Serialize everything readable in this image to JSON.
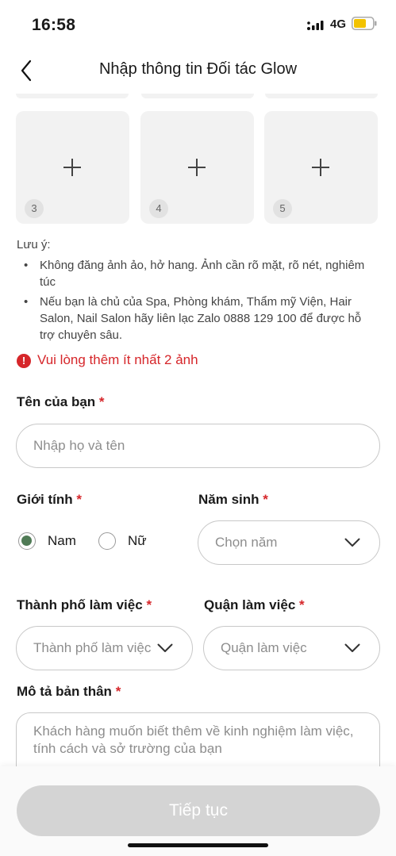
{
  "status_bar": {
    "time": "16:58",
    "network": "4G",
    "icons": [
      "signal-icon",
      "battery-icon"
    ]
  },
  "nav": {
    "title": "Nhập thông tin Đối tác Glow",
    "back_icon": "chevron-left-icon"
  },
  "photos": {
    "slots": [
      {
        "number": "3"
      },
      {
        "number": "4"
      },
      {
        "number": "5"
      }
    ],
    "add_icon": "plus-icon"
  },
  "note": {
    "label": "Lưu ý:",
    "bullets": [
      "Không đăng ảnh ảo, hở hang. Ảnh cần rõ mặt, rõ nét, nghiêm túc",
      "Nếu bạn là chủ của Spa, Phòng khám, Thẩm mỹ Viện, Hair Salon, Nail Salon hãy liên lạc Zalo 0888 129 100 để được hỗ trợ chuyên sâu."
    ],
    "bullet_glyph": "•"
  },
  "error": {
    "icon": "!",
    "text": "Vui lòng thêm ít nhất 2 ảnh",
    "color": "#d6262a"
  },
  "form": {
    "required_mark": "*",
    "name": {
      "label": "Tên của bạn",
      "placeholder": "Nhập họ và tên"
    },
    "gender": {
      "label": "Giới tính",
      "options": [
        {
          "label": "Nam",
          "selected": true
        },
        {
          "label": "Nữ",
          "selected": false
        }
      ],
      "accent": "#4f7a55"
    },
    "birth_year": {
      "label": "Năm sinh",
      "placeholder": "Chọn năm"
    },
    "city": {
      "label": "Thành phố làm việc",
      "placeholder": "Thành phố làm việc"
    },
    "district": {
      "label": "Quận làm việc",
      "placeholder": "Quận làm việc"
    },
    "about": {
      "label": "Mô tả bản thân",
      "placeholder": "Khách hàng muốn biết thêm về kinh nghiệm làm việc, tính cách và sở trường của bạn"
    }
  },
  "footer": {
    "continue_label": "Tiếp tục",
    "continue_enabled": false
  }
}
